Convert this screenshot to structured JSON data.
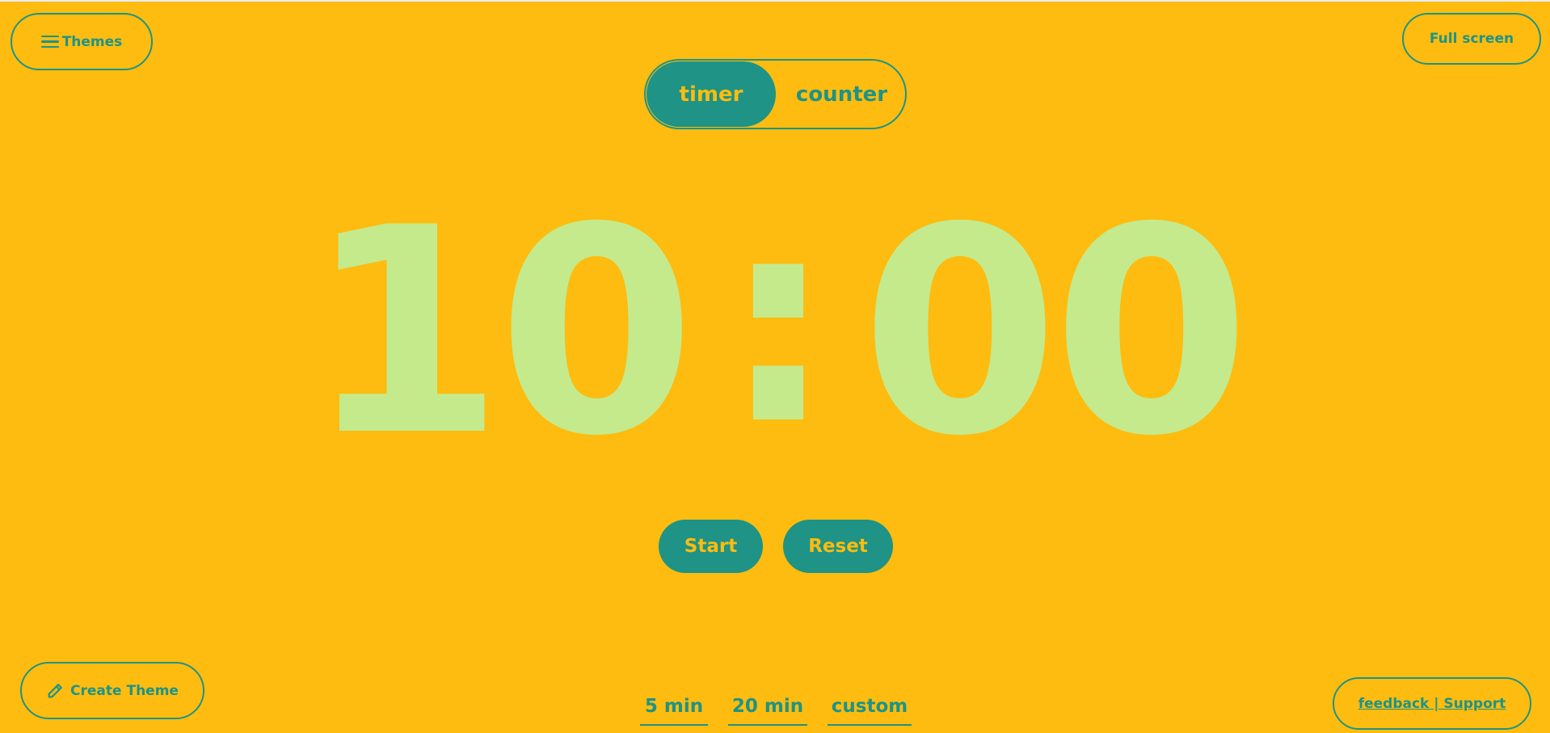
{
  "header": {
    "themes_label": "Themes",
    "fullscreen_label": "Full screen"
  },
  "mode": {
    "timer_label": "timer",
    "counter_label": "counter",
    "active": "timer"
  },
  "clock": {
    "minutes": "10",
    "separator": ":",
    "seconds": "00"
  },
  "actions": {
    "start_label": "Start",
    "reset_label": "Reset"
  },
  "presets": [
    {
      "label": "5 min"
    },
    {
      "label": "20 min"
    },
    {
      "label": "custom"
    }
  ],
  "footer": {
    "create_theme_label": "Create Theme",
    "feedback_label": "feedback | Support"
  },
  "icons": {
    "themes": "hamburger-icon",
    "create_theme": "pencil-icon"
  },
  "colors": {
    "background": "#FDBC0F",
    "accent": "#1E9386",
    "digits": "#C5EA8C"
  }
}
